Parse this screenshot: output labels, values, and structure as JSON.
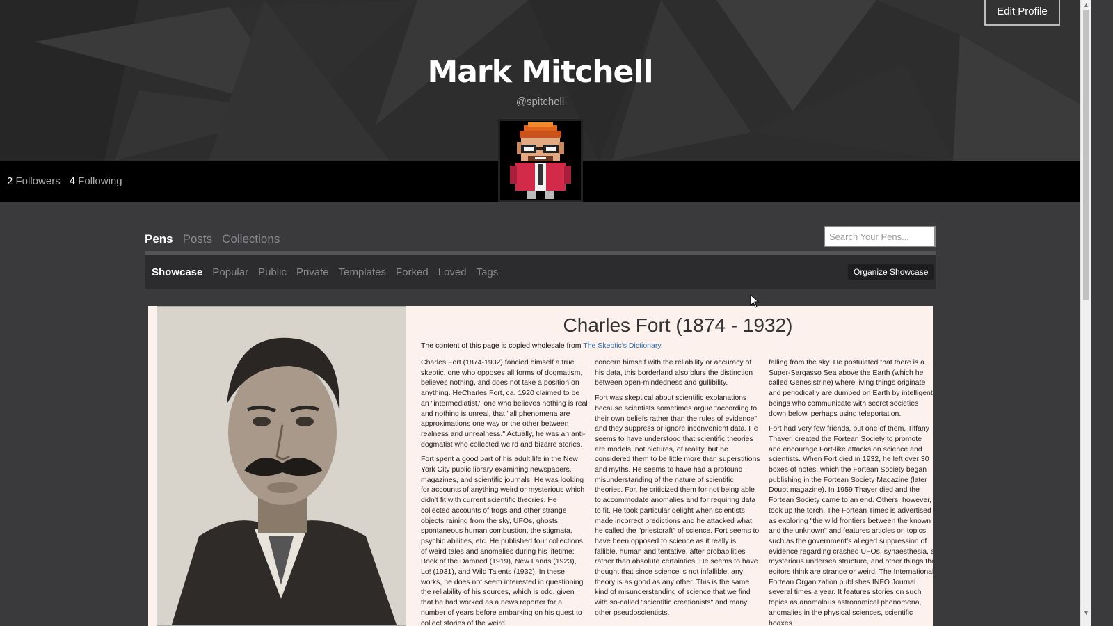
{
  "header": {
    "edit_profile_label": "Edit Profile",
    "name": "Mark Mitchell",
    "handle": "@spitchell",
    "followers_count": "2",
    "followers_label": "Followers",
    "following_count": "4",
    "following_label": "Following"
  },
  "tabs": {
    "pens": "Pens",
    "posts": "Posts",
    "collections": "Collections"
  },
  "search": {
    "placeholder": "Search Your Pens..."
  },
  "subtabs": {
    "showcase": "Showcase",
    "popular": "Popular",
    "public": "Public",
    "private": "Private",
    "templates": "Templates",
    "forked": "Forked",
    "loved": "Loved",
    "tags": "Tags",
    "organize": "Organize Showcase"
  },
  "card": {
    "title": "Charles Fort (1874 - 1932)",
    "intro_text": "The content of this page is copied wholesale from",
    "intro_link": "The Skeptic's Dictionary",
    "intro_end": ".",
    "col1_p1": "Charles Fort (1874-1932) fancied himself a true skeptic, one who opposes all forms of dogmatism, believes nothing, and does not take a position on anything. HeCharles Fort, ca. 1920 claimed to be an \"intermediatist,\" one who believes nothing is real and nothing is unreal, that \"all phenomena are approximations one way or the other between realness and unrealness.\" Actually, he was an anti-dogmatist who collected weird and bizarre stories.",
    "col1_p2": "Fort spent a good part of his adult life in the New York City public library examining newspapers, magazines, and scientific journals. He was looking for accounts of anything weird or mysterious which didn't fit with current scientific theories. He collected accounts of frogs and other strange objects raining from the sky, UFOs, ghosts, spontaneous human combustion, the stigmata, psychic abilities, etc. He published four collections of weird tales and anomalies during his lifetime: Book of the Damned (1919), New Lands (1923), Lo! (1931), and Wild Talents (1932). In these works, he does not seem interested in questioning the reliability of his sources, which is odd, given that he had worked as a news reporter for a number of years before embarking on his quest to collect stories of the weird",
    "col2_p1": "concern himself with the reliability or accuracy of his data, this borderland also blurs the distinction between open-mindedness and gullibility.",
    "col2_p2": "Fort was skeptical about scientific explanations because scientists sometimes argue \"according to their own beliefs rather than the rules of evidence\" and they suppress or ignore inconvenient data. He seems to have understood that scientific theories are models, not pictures, of reality, but he considered them to be little more than superstitions and myths. He seems to have had a profound misunderstanding of the nature of scientific theories. For, he criticized them for not being able to accommodate anomalies and for requiring data to fit. He took particular delight when scientists made incorrect predictions and he attacked what he called the \"priestcraft\" of science. Fort seems to have been opposed to science as it really is: fallible, human and tentative, after probabilities rather than absolute certainties. He seems to have thought that since science is not infallible, any theory is as good as any other. This is the same kind of misunderstanding of science that we find with so-called \"scientific creationists\" and many other pseudoscientists.",
    "col3_p1": "falling from the sky. He postulated that there is a Super-Sargasso Sea above the Earth (which he called Genesistrine) where living things originate and periodically are dumped on Earth by intelligent beings who communicate with secret societies down below, perhaps using teleportation.",
    "col3_p2": "Fort had very few friends, but one of them, Tiffany Thayer, created the Fortean Society to promote and encourage Fort-like attacks on science and scientists. When Fort died in 1932, he left over 30 boxes of notes, which the Fortean Society began publishing in the Fortean Society Magazine (later Doubt magazine). In 1959 Thayer died and the Fortean Society came to an end. Others, however, took up the torch. The Fortean Times is advertised as exploring \"the wild frontiers between the known and the unknown\" and features articles on topics such as the government's alleged suppression of evidence regarding crashed UFOs, synaesthesia, a mysterious undersea structure, and other things the editors think are strange or weird. The International Fortean Organization publishes INFO Journal several times a year. It features stories on such topics as anomalous astronomical phenomena, anomalies in the physical sciences, scientific hoaxes"
  }
}
